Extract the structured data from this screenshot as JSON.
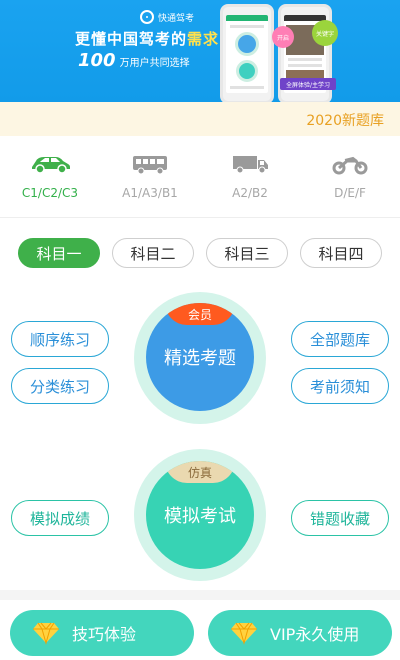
{
  "banner": {
    "brand": "快通驾考",
    "headline_part1": "更懂",
    "headline_part2": "中国驾考的",
    "headline_part3": "需求",
    "users_number": "100",
    "users_text": "万用户共同选择",
    "bubble1": "开启",
    "bubble2": "关键字",
    "purple_label": "全屏体验/主学习"
  },
  "strip": {
    "label": "2020新题库"
  },
  "license_categories": [
    {
      "label": "C1/C2/C3",
      "icon": "car-icon",
      "active": true
    },
    {
      "label": "A1/A3/B1",
      "icon": "bus-icon",
      "active": false
    },
    {
      "label": "A2/B2",
      "icon": "truck-icon",
      "active": false
    },
    {
      "label": "D/E/F",
      "icon": "motorcycle-icon",
      "active": false
    }
  ],
  "subject_tabs": [
    "科目一",
    "科目二",
    "科目三",
    "科目四"
  ],
  "practice": {
    "left_top": "顺序练习",
    "left_bottom": "分类练习",
    "right_top": "全部题库",
    "right_bottom": "考前须知",
    "circle_badge": "会员",
    "circle_title": "精选考题"
  },
  "exam": {
    "left": "模拟成绩",
    "right": "错题收藏",
    "circle_badge": "仿真",
    "circle_title": "模拟考试"
  },
  "bottom": {
    "left_label": "技巧体验",
    "right_label": "VIP永久使用",
    "icon": "diamond-icon"
  },
  "colors": {
    "banner_blue": "#1aa3f0",
    "active_green": "#3fb04a",
    "practice_blue": "#3d9be6",
    "exam_teal": "#37d3b4",
    "badge_orange": "#ff5a1f",
    "button_teal": "#43d6bd",
    "strip_orange": "#e8a022"
  }
}
